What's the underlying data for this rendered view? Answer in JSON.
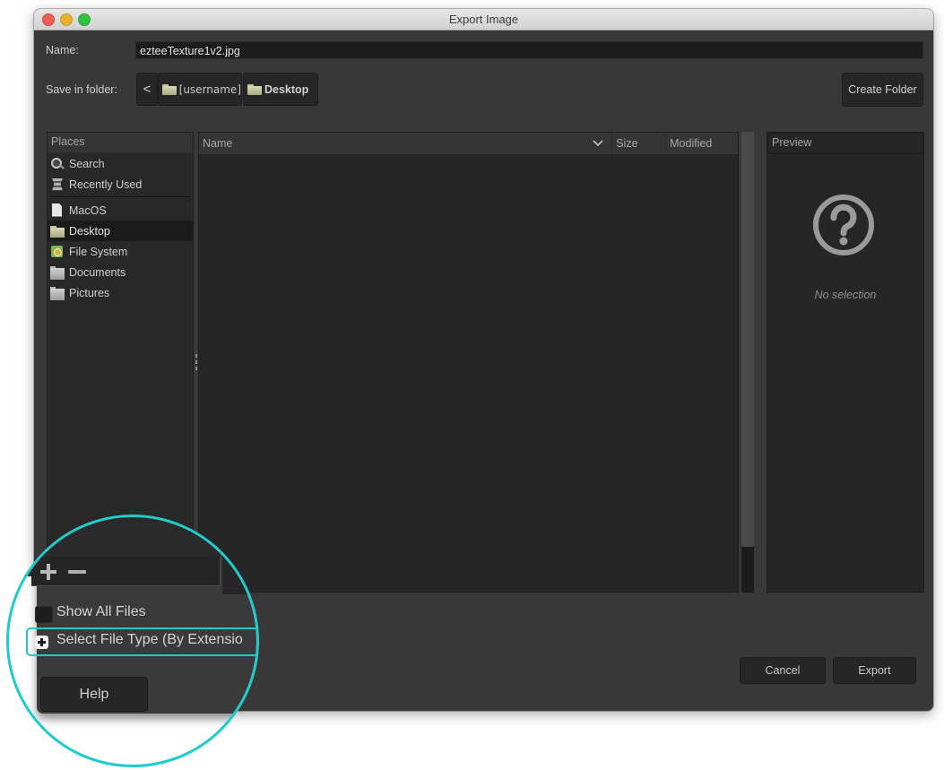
{
  "window": {
    "title": "Export Image",
    "controls": [
      "close",
      "minimize",
      "maximize"
    ]
  },
  "form": {
    "name_label": "Name:",
    "name_value": "ezteeTexture1v2.jpg",
    "save_in_label": "Save in folder:",
    "breadcrumb": {
      "back_icon": "chevron-left-icon",
      "back_glyph": "<",
      "items": [
        {
          "label": "[username]",
          "icon": "folder-icon",
          "active": false
        },
        {
          "label": "Desktop",
          "icon": "folder-icon",
          "active": true
        }
      ]
    },
    "create_folder_label": "Create Folder"
  },
  "places": {
    "header": "Places",
    "items": [
      {
        "label": "Search",
        "icon": "search-icon"
      },
      {
        "label": "Recently Used",
        "icon": "recently-used-icon"
      },
      {
        "label": "MacOS",
        "icon": "drive-icon"
      },
      {
        "label": "Desktop",
        "icon": "folder-icon",
        "selected": true
      },
      {
        "label": "File System",
        "icon": "file-system-icon"
      },
      {
        "label": "Documents",
        "icon": "folder-icon"
      },
      {
        "label": "Pictures",
        "icon": "folder-icon"
      }
    ],
    "add_glyph": "+",
    "remove_glyph": "−"
  },
  "file_list": {
    "columns": [
      {
        "label": "Name",
        "sorted": true,
        "sort_icon": "chevron-down-icon"
      },
      {
        "label": "Size"
      },
      {
        "label": "Modified"
      }
    ],
    "rows": []
  },
  "preview": {
    "header": "Preview",
    "icon": "question-circle-icon",
    "empty_text": "No selection"
  },
  "options": {
    "show_all_files_label": "Show All Files",
    "show_all_files_checked": false,
    "select_file_type_label": "Select File Type (By Extensio",
    "select_file_type_expanded": false
  },
  "buttons": {
    "help": "Help",
    "cancel": "Cancel",
    "export": "Export"
  },
  "annotation": {
    "highlight_color": "#1fcbcc"
  }
}
